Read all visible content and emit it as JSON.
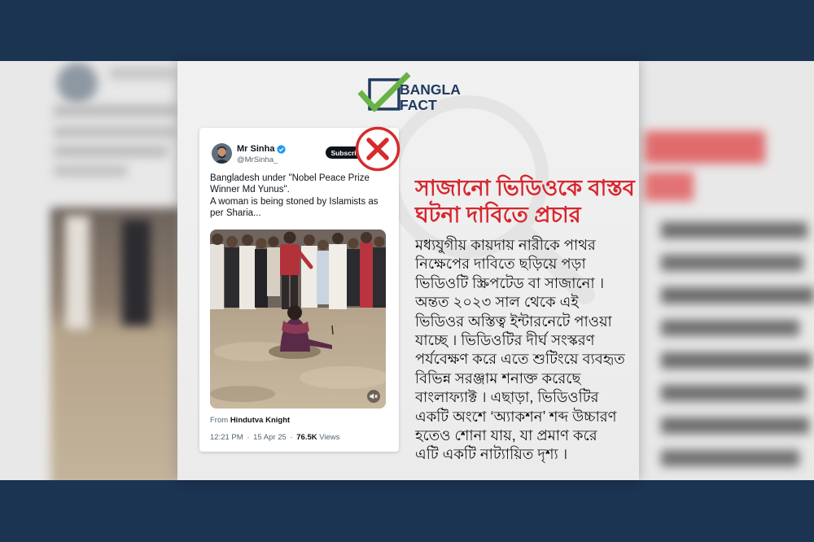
{
  "theme": {
    "colors": {
      "band": "#1b3452",
      "card_bg": "#eeeeee",
      "headline_red": "#d7262e",
      "logo_navy": "#1f3a5f",
      "logo_green": "#67b346",
      "verified_blue": "#1d9bf0",
      "false_marker_red": "#d62b2b"
    }
  },
  "icons": {
    "logo_mark": "checkmark-square-icon",
    "verified": "verified-badge-icon",
    "false_marker": "red-x-circle-icon",
    "mute": "mute-speaker-icon",
    "watermark": "magnifying-glass-icon"
  },
  "logo": {
    "line1": "BANGLA",
    "line2": "FACT"
  },
  "tweet": {
    "author_name": "Mr Sinha",
    "handle": "@MrSinha_",
    "subscribe_label": "Subscribe",
    "text_para1": "Bangladesh under \"Nobel Peace Prize Winner Md Yunus\".",
    "text_para2": "A woman is being stoned by Islamists as per Sharia...",
    "source_prefix": "From",
    "source_name": "Hindutva Knight",
    "time": "12:21 PM",
    "separator": "·",
    "date": "15 Apr 25",
    "views_count": "76.5K",
    "views_label": "Views"
  },
  "verdict": {
    "headline_line1": "সাজানো ভিডিওকে বাস্তব",
    "headline_line2": "ঘটনা দাবিতে প্রচার",
    "body_lines": [
      "মধ্যযুগীয় কায়দায় নারীকে পাথর",
      "নিক্ষেপের দাবিতে ছড়িয়ে পড়া",
      "ভিডিওটি স্ক্রিপটেড বা সাজানো ।",
      "অন্তত ২০২৩ সাল থেকে এই",
      "ভিডিওর অস্তিত্ব ইন্টারনেটে পাওয়া",
      "যাচ্ছে । ভিডিওটির দীর্ঘ সংস্করণ",
      "পর্যবেক্ষণ করে এতে শুটিংয়ে ব্যবহৃত",
      "বিভিন্ন সরঞ্জাম শনাক্ত করেছে",
      "বাংলাফ্যাক্ট । এছাড়া, ভিডিওটির",
      "একটি অংশে ‘অ্যাকশন’ শব্দ উচ্চারণ",
      "হতেও শোনা যায়, যা প্রমাণ করে",
      "এটি একটি নাট্যায়িত দৃশ্য ।"
    ]
  }
}
